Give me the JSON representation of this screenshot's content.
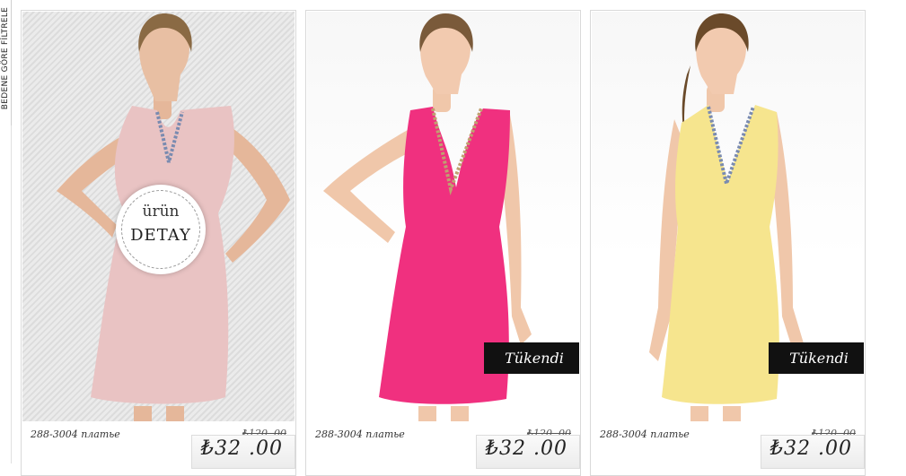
{
  "sidebar": {
    "filter_tab_label": "BEDENE GÖRE FİLTRELE"
  },
  "overlay": {
    "line1": "ürün",
    "line2": "DETAY"
  },
  "products": [
    {
      "name": "288-3004 платье",
      "old_price": "₺120 .00",
      "price": "₺32 .00",
      "status": "",
      "dress_color": "#e9c3c3"
    },
    {
      "name": "288-3004 платье",
      "old_price": "₺120 .00",
      "price": "₺32 .00",
      "status": "Tükendi",
      "dress_color": "#f0307f"
    },
    {
      "name": "288-3004 платье",
      "old_price": "₺120 .00",
      "price": "₺32 .00",
      "status": "Tükendi",
      "dress_color": "#f6e58e"
    }
  ]
}
